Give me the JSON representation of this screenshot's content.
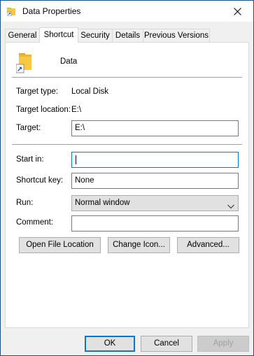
{
  "window": {
    "title": "Data Properties"
  },
  "tabs": [
    {
      "label": "General",
      "active": false
    },
    {
      "label": "Shortcut",
      "active": true
    },
    {
      "label": "Security",
      "active": false
    },
    {
      "label": "Details",
      "active": false
    },
    {
      "label": "Previous Versions",
      "active": false
    }
  ],
  "shortcut": {
    "name": "Data",
    "target_type_label": "Target type:",
    "target_type_value": "Local Disk",
    "target_location_label": "Target location:",
    "target_location_value": "E:\\",
    "target_label": "Target:",
    "target_value": "E:\\",
    "start_in_label": "Start in:",
    "start_in_value": "",
    "shortcut_key_label": "Shortcut key:",
    "shortcut_key_value": "None",
    "run_label": "Run:",
    "run_value": "Normal window",
    "comment_label": "Comment:",
    "comment_value": ""
  },
  "buttons": {
    "open_file_location": "Open File Location",
    "change_icon": "Change Icon...",
    "advanced": "Advanced..."
  },
  "footer": {
    "ok": "OK",
    "cancel": "Cancel",
    "apply": "Apply"
  },
  "icons": {
    "app": "folder-shortcut-icon",
    "shortcut": "folder-shortcut-icon",
    "close": "close-icon",
    "dropdown": "chevron-down-icon"
  },
  "colors": {
    "accent": "#0078d7",
    "border": "#1b4f8a",
    "folder": "#f8c843"
  }
}
